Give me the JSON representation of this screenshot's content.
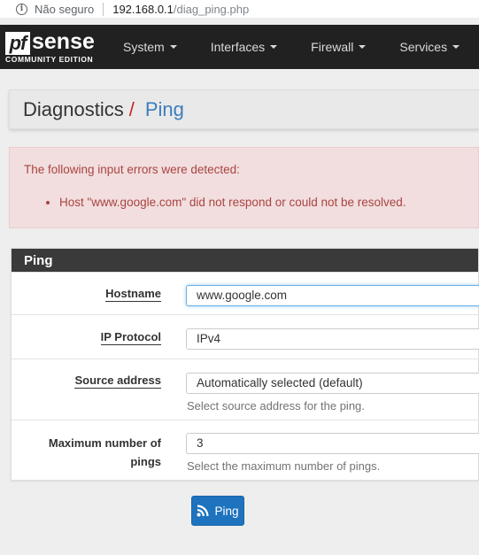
{
  "browser": {
    "security_label": "Não seguro",
    "url_host": "192.168.0.1",
    "url_path": "/diag_ping.php"
  },
  "navbar": {
    "logo_pf": "pf",
    "logo_sense": "sense",
    "logo_edition": "COMMUNITY EDITION",
    "items": [
      {
        "label": "System"
      },
      {
        "label": "Interfaces"
      },
      {
        "label": "Firewall"
      },
      {
        "label": "Services"
      }
    ]
  },
  "breadcrumb": {
    "section": "Diagnostics",
    "separator": "/",
    "page": "Ping"
  },
  "alert": {
    "heading": "The following input errors were detected:",
    "errors": [
      "Host \"www.google.com\" did not respond or could not be resolved."
    ]
  },
  "panel": {
    "title": "Ping",
    "hostname": {
      "label": "Hostname",
      "value": "www.google.com"
    },
    "ip_protocol": {
      "label": "IP Protocol",
      "value": "IPv4"
    },
    "source_address": {
      "label": "Source address",
      "value": "Automatically selected (default)",
      "help": "Select source address for the ping."
    },
    "max_pings": {
      "label_line1": "Maximum number of",
      "label_line2": "pings",
      "value": "3",
      "help": "Select the maximum number of pings."
    }
  },
  "actions": {
    "ping_label": "Ping"
  },
  "colors": {
    "navbar_bg": "#212121",
    "alert_bg": "#f2dede",
    "alert_text": "#a94442",
    "primary_button": "#1e73be",
    "breadcrumb_link": "#3c7dbd",
    "breadcrumb_separator": "#cc2222"
  }
}
